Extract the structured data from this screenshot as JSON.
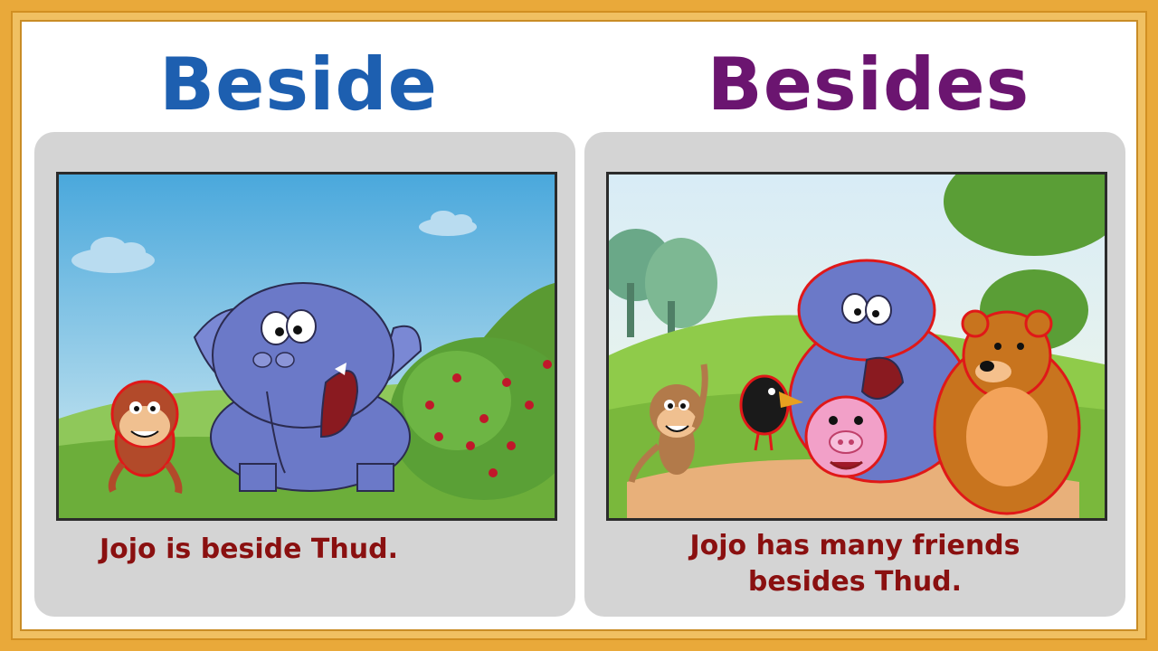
{
  "colors": {
    "frame": "#e9a93a",
    "beside_title": "#1d5fb0",
    "besides_title": "#6b1570",
    "caption": "#8a1010",
    "panel": "#d4d4d4"
  },
  "left": {
    "title": "Beside",
    "caption": "Jojo is beside Thud."
  },
  "right": {
    "title": "Besides",
    "caption_line1": "Jojo has many friends",
    "caption_line2": "besides Thud."
  },
  "icons": {
    "left_scene": "monkey-beside-elephant-illustration",
    "right_scene": "monkey-with-friends-illustration"
  }
}
